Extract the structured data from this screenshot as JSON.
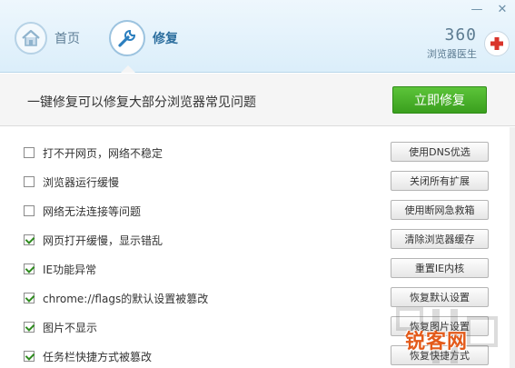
{
  "window": {
    "minimize_glyph": "—",
    "close_glyph": "✕"
  },
  "nav": {
    "home_label": "首页",
    "repair_label": "修复"
  },
  "brand": {
    "number": "360",
    "name": "浏览器医生"
  },
  "banner": {
    "text": "一键修复可以修复大部分浏览器常见问题",
    "fix_now_label": "立即修复"
  },
  "issues": [
    {
      "label": "打不开网页，网络不稳定",
      "checked": false,
      "button": "使用DNS优选"
    },
    {
      "label": "浏览器运行缓慢",
      "checked": false,
      "button": "关闭所有扩展"
    },
    {
      "label": "网络无法连接等问题",
      "checked": false,
      "button": "使用断网急救箱"
    },
    {
      "label": "网页打开缓慢，显示错乱",
      "checked": true,
      "button": "清除浏览器缓存"
    },
    {
      "label": "IE功能异常",
      "checked": true,
      "button": "重置IE内核"
    },
    {
      "label": "chrome://flags的默认设置被篡改",
      "checked": true,
      "button": "恢复默认设置"
    },
    {
      "label": "图片不显示",
      "checked": true,
      "button": "恢复图片设置"
    },
    {
      "label": "任务栏快捷方式被篡改",
      "checked": true,
      "button": "恢复快捷方式"
    }
  ],
  "watermark": {
    "text": "锐客网"
  },
  "colors": {
    "accent_green": "#3a9f1e",
    "header_blue": "#dbeefa",
    "check_green": "#2e8b1e",
    "watermark_orange": "#e35a1a"
  }
}
